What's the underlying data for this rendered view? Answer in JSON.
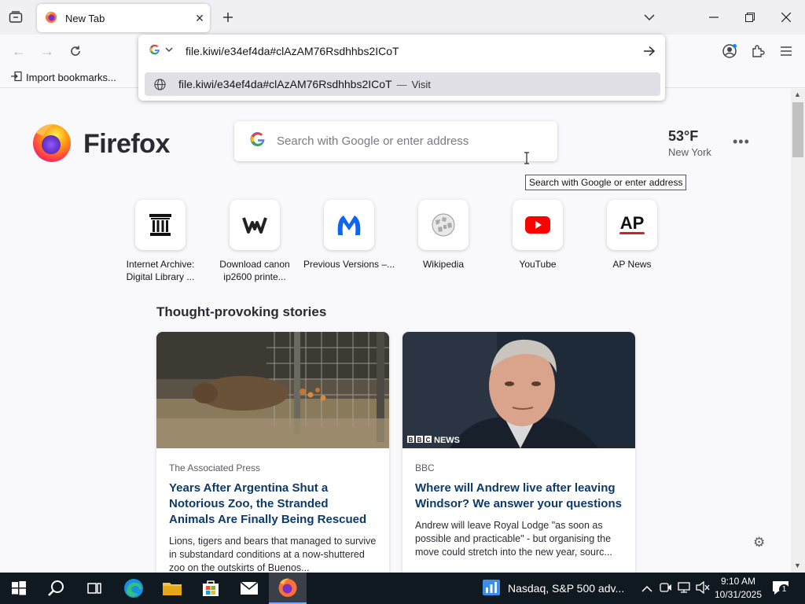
{
  "tab": {
    "title": "New Tab"
  },
  "urlbar": {
    "value": "file.kiwi/e34ef4da#clAzAM76Rsdhhbs2ICoT",
    "suggestion": "file.kiwi/e34ef4da#clAzAM76Rsdhhbs2ICoT",
    "suggestion_sep": "—",
    "suggestion_action": "Visit"
  },
  "bookmarks": {
    "import_label": "Import bookmarks..."
  },
  "brand": {
    "name": "Firefox"
  },
  "search": {
    "placeholder": "Search with Google or enter address",
    "tooltip": "Search with Google or enter address"
  },
  "weather": {
    "temp": "53°F",
    "city": "New York"
  },
  "topsites": [
    {
      "label": "Internet Archive: Digital Library ...",
      "icon": "internet-archive-icon"
    },
    {
      "label": "Download canon ip2600 printe...",
      "icon": "wikihow-icon"
    },
    {
      "label": "Previous Versions –...",
      "icon": "malwarebytes-icon"
    },
    {
      "label": "Wikipedia",
      "icon": "wikipedia-icon"
    },
    {
      "label": "YouTube",
      "icon": "youtube-icon"
    },
    {
      "label": "AP News",
      "icon": "ap-news-icon"
    }
  ],
  "stories": {
    "title": "Thought-provoking stories",
    "items": [
      {
        "source": "The Associated Press",
        "headline": "Years After Argentina Shut a Notorious Zoo, the Stranded Animals Are Finally Being Rescued",
        "excerpt": "Lions, tigers and bears that managed to survive in substandard conditions at a now-shuttered zoo on the outskirts of Buenos..."
      },
      {
        "source": "BBC",
        "image_badge": "NEWS",
        "headline": "Where will Andrew live after leaving Windsor? We answer your questions",
        "excerpt": "Andrew will leave Royal Lodge \"as soon as possible and practicable\" - but organising the move could stretch into the new year, sourc..."
      }
    ]
  },
  "taskbar": {
    "news": "Nasdaq, S&P 500 adv...",
    "time": "9:10 AM",
    "date": "10/31/2025",
    "notification_count": "1"
  },
  "colors": {
    "accent": "#0060df",
    "headline": "#0d3a6b",
    "taskbar": "#101820"
  }
}
